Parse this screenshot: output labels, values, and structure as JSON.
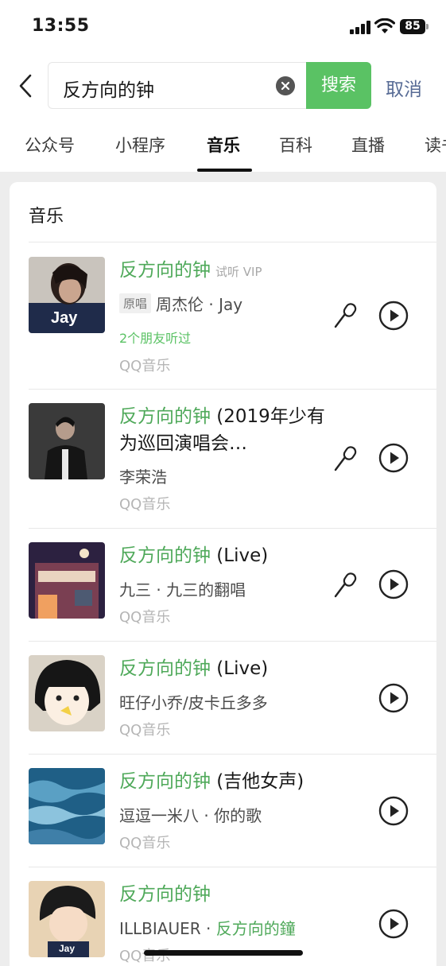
{
  "status_bar": {
    "time": "13:55",
    "battery": "85"
  },
  "search": {
    "query": "反方向的钟",
    "search_label": "搜索",
    "cancel_label": "取消"
  },
  "tabs": [
    {
      "label": "公众号"
    },
    {
      "label": "小程序"
    },
    {
      "label": "音乐",
      "active": true
    },
    {
      "label": "百科"
    },
    {
      "label": "直播"
    },
    {
      "label": "读书"
    }
  ],
  "section": {
    "title": "音乐"
  },
  "songs": [
    {
      "title_highlight": "反方向的钟",
      "title_rest": "",
      "tag": "试听 VIP",
      "badge": "原唱",
      "artist": "周杰伦 · Jay",
      "friends": "2个朋友听过",
      "source": "QQ音乐",
      "cover_text": "Jay",
      "has_mic": true
    },
    {
      "title_highlight": "反方向的钟",
      "title_rest": " (2019年少有为巡回演唱会…",
      "artist": "李荣浩",
      "source": "QQ音乐",
      "has_mic": true
    },
    {
      "title_highlight": "反方向的钟",
      "title_rest": " (Live)",
      "artist": "九三 · 九三的翻唱",
      "source": "QQ音乐",
      "has_mic": true
    },
    {
      "title_highlight": "反方向的钟",
      "title_rest": " (Live)",
      "artist": "旺仔小乔/皮卡丘多多",
      "source": "QQ音乐",
      "has_mic": false
    },
    {
      "title_highlight": "反方向的钟",
      "title_rest": " (吉他女声)",
      "artist": "逗逗一米八 · 你的歌",
      "source": "QQ音乐",
      "has_mic": false
    },
    {
      "title_highlight": "反方向的钟",
      "title_rest": "",
      "artist": "ILLBIAUER · ",
      "artist_highlight": "反方向的鐘",
      "source": "QQ音乐",
      "cover_text": "Jay",
      "has_mic": false
    }
  ],
  "colors": {
    "accent_green": "#5ac264",
    "link_blue": "#576b95",
    "highlight": "#4fa95a"
  }
}
